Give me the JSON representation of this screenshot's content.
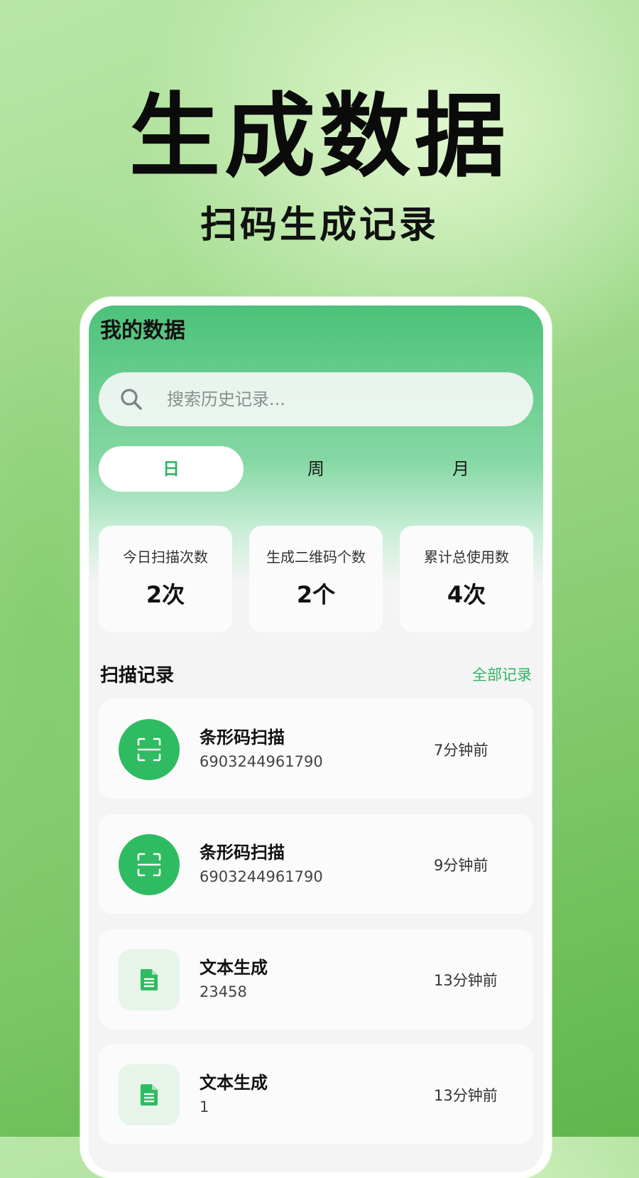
{
  "hero": {
    "title": "生成数据",
    "subtitle": "扫码生成记录"
  },
  "screen": {
    "title": "我的数据"
  },
  "search": {
    "placeholder": "搜索历史记录..."
  },
  "tabs": [
    {
      "label": "日",
      "active": true
    },
    {
      "label": "周",
      "active": false
    },
    {
      "label": "月",
      "active": false
    }
  ],
  "stats": [
    {
      "label": "今日扫描次数",
      "value": "2次"
    },
    {
      "label": "生成二维码个数",
      "value": "2个"
    },
    {
      "label": "累计总使用数",
      "value": "4次"
    }
  ],
  "records_section": {
    "title": "扫描记录",
    "link": "全部记录"
  },
  "records": [
    {
      "icon": "barcode-scan-icon",
      "title": "条形码扫描",
      "content": "6903244961790",
      "time": "7分钟前"
    },
    {
      "icon": "barcode-scan-icon",
      "title": "条形码扫描",
      "content": "6903244961790",
      "time": "9分钟前"
    },
    {
      "icon": "document-icon",
      "title": "文本生成",
      "content": "23458",
      "time": "13分钟前"
    },
    {
      "icon": "document-icon",
      "title": "文本生成",
      "content": "1",
      "time": "13分钟前"
    }
  ],
  "colors": {
    "accent": "#2fb565",
    "icon_circle": "#2fbb62",
    "icon_square_bg": "#e6f4ea"
  }
}
